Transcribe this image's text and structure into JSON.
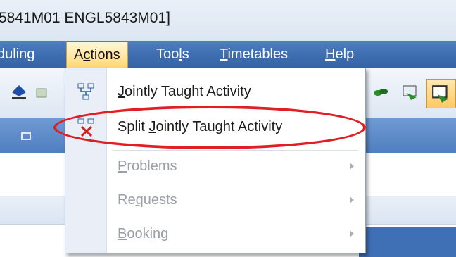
{
  "window": {
    "title": "5841M01 ENGL5843M01]"
  },
  "menubar": {
    "items": [
      {
        "id": "scheduling",
        "label_pre": "",
        "label_u": "",
        "label_post": "duling"
      },
      {
        "id": "actions",
        "label_pre": "A",
        "label_u": "c",
        "label_post": "tions"
      },
      {
        "id": "tools",
        "label_pre": "Too",
        "label_u": "l",
        "label_post": "s"
      },
      {
        "id": "timetables",
        "label_pre": "",
        "label_u": "T",
        "label_post": "imetables"
      },
      {
        "id": "help",
        "label_pre": "",
        "label_u": "H",
        "label_post": "elp"
      }
    ]
  },
  "actions_menu": {
    "items": [
      {
        "pre": "",
        "u": "J",
        "post": "ointly Taught Activity",
        "enabled": true,
        "submenu": false,
        "icon": "jointly-taught-icon"
      },
      {
        "pre": "Split ",
        "u": "J",
        "post": "ointly Taught Activity",
        "enabled": true,
        "submenu": false,
        "icon": "split-activity-icon"
      },
      {
        "pre": "",
        "u": "P",
        "post": "roblems",
        "enabled": false,
        "submenu": true,
        "icon": ""
      },
      {
        "pre": "Re",
        "u": "q",
        "post": "uests",
        "enabled": false,
        "submenu": true,
        "icon": ""
      },
      {
        "pre": "",
        "u": "B",
        "post": "ooking",
        "enabled": false,
        "submenu": true,
        "icon": ""
      }
    ]
  },
  "annotation": {
    "color": "#e01e24",
    "target": "Split Jointly Taught Activity"
  },
  "colors": {
    "menubar": "#3d6db0",
    "active_menu": "#ffe8a6",
    "disabled_text": "#9aa0a8"
  }
}
